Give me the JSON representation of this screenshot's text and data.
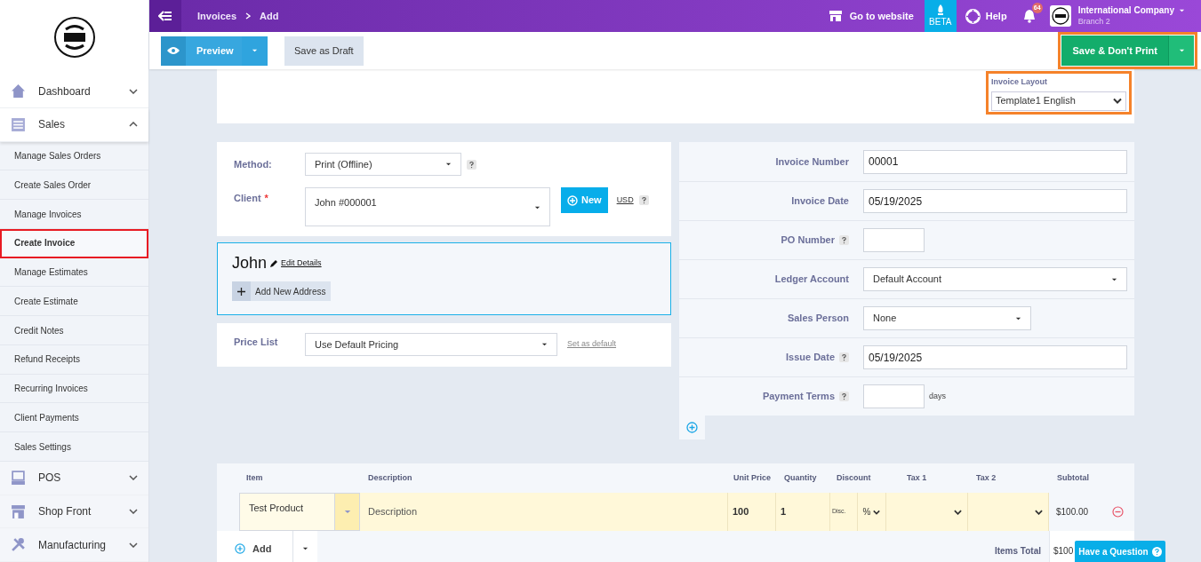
{
  "topbar": {
    "breadcrumb": [
      "Invoices",
      "Add"
    ],
    "links": [
      {
        "kind": "website",
        "label": "Go to website"
      },
      {
        "kind": "beta",
        "label": "BETA"
      },
      {
        "kind": "help",
        "label": "Help"
      }
    ],
    "notifications": "64",
    "company": "International Company",
    "branch": "Branch 2"
  },
  "toolbar": {
    "preview": "Preview",
    "draft": "Save as Draft",
    "save": {
      "label": "Save & Don't Print",
      "highlighted": true
    }
  },
  "sidebar": [
    {
      "kind": "home",
      "label": "Dashboard",
      "expanded": false
    },
    {
      "kind": "list",
      "label": "Sales",
      "expanded": true,
      "children": [
        {
          "label": "Manage Sales Orders",
          "selected": false
        },
        {
          "label": "Create Sales Order",
          "selected": false
        },
        {
          "label": "Manage Invoices",
          "selected": false
        },
        {
          "label": "Create Invoice",
          "selected": true
        },
        {
          "label": "Manage Estimates",
          "selected": false
        },
        {
          "label": "Create Estimate",
          "selected": false
        },
        {
          "label": "Credit Notes",
          "selected": false
        },
        {
          "label": "Refund Receipts",
          "selected": false
        },
        {
          "label": "Recurring Invoices",
          "selected": false
        },
        {
          "label": "Client Payments",
          "selected": false
        },
        {
          "label": "Sales Settings",
          "selected": false
        }
      ]
    },
    {
      "kind": "pos",
      "label": "POS",
      "expanded": false
    },
    {
      "kind": "shop",
      "label": "Shop Front",
      "expanded": false
    },
    {
      "kind": "tools",
      "label": "Manufacturing",
      "expanded": false
    }
  ],
  "layout": {
    "label": "Invoice Layout",
    "value": "Template1 English",
    "highlighted": true
  },
  "client_form": {
    "method_label": "Method:",
    "method": "Print (Offline)",
    "client_label": "Client",
    "required_mark": "*",
    "client": "John #000001",
    "new_button": "New",
    "currency": "USD"
  },
  "client_card": {
    "name": "John",
    "edit": "Edit Details",
    "add_address": "Add New Address"
  },
  "price_list": {
    "label": "Price List",
    "value": "Use Default Pricing",
    "set_default": "Set as default"
  },
  "invoice_fields": [
    {
      "label": "Invoice Number",
      "value": "00001",
      "kind": "text",
      "help": false
    },
    {
      "label": "Invoice Date",
      "value": "05/19/2025",
      "kind": "text",
      "help": false
    },
    {
      "label": "PO Number",
      "kind": "short_text",
      "help": true
    },
    {
      "label": "Ledger Account",
      "value": "Default Account",
      "kind": "select",
      "help": false
    },
    {
      "label": "Sales Person",
      "value": "None",
      "kind": "short_select",
      "help": false
    },
    {
      "label": "Issue Date",
      "value": "05/19/2025",
      "kind": "text",
      "help": true
    },
    {
      "label": "Payment Terms",
      "kind": "short_text",
      "help": true,
      "suffix": "days"
    }
  ],
  "table": {
    "columns": [
      "Item",
      "Description",
      "Unit Price",
      "Quantity",
      "Discount",
      "Tax 1",
      "Tax 2",
      "Subtotal"
    ],
    "rows": [
      {
        "item": "Test Product",
        "description_placeholder": "Description",
        "unit_price": "100",
        "quantity": "1",
        "discount_placeholder": "Disc.",
        "discount_type": "%",
        "subtotal": "$100.00"
      }
    ]
  },
  "add_button": "Add",
  "items_total": {
    "label": "Items Total",
    "value": "$100"
  },
  "question_button": "Have a Question"
}
